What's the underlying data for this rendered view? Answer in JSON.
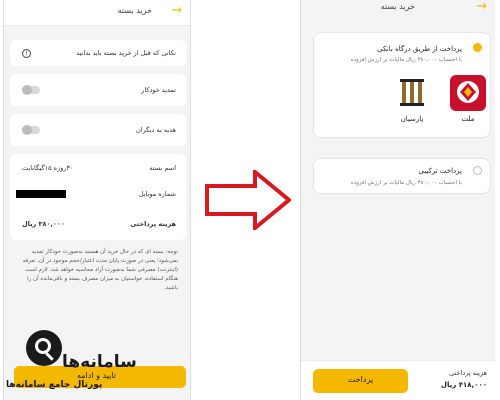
{
  "left_screen": {
    "title": "خرید بسته",
    "notice": "نکاتی که قبل از خرید بسته باید بدانید",
    "auto_renew_label": "تمدید خودکار",
    "gift_label": "هدیه به دیگران",
    "package_name_label": "اسم بسته",
    "package_name_value": "۳۰روزه ۱۵گیگابایت",
    "mobile_label": "شماره موبایل",
    "payment_label": "هزینه پرداختی",
    "payment_value": "۳۸۰,۰۰۰ ریال",
    "note": "توجه: بسته ای که در حال خرید آن هستید به‌صورت خودکار تمدید نمی‌شود؛ یعنی در صورت پایان مدت اعتبار/حجم موجود در آن، تعرفه (اینترنت) مصرفی شما به‌صورت آزاد محاسبه خواهد شد. لازم است هنگام استفاده، خواستیان به میزان مصرف بسته و باقی‌مانده آن را باشید.",
    "confirm_label": "تایید و ادامه"
  },
  "watermark": {
    "main": "سامانه‌ها",
    "sub": "پورتال جامع سامانه‌ها"
  },
  "right_screen": {
    "title": "خرید بسته",
    "bank_option_title": "پرداخت از طریق درگاه بانکی",
    "bank_option_sub": "با احتساب ۳۸۰,۰۰۰ ریال مالیات بر ارزش افزوده",
    "banks": [
      {
        "name": "ملت"
      },
      {
        "name": "پارسیان"
      }
    ],
    "combo_option_title": "پرداخت ترکیبی",
    "combo_option_sub": "با احتساب ۳۸۰,۰۰۰ ریال مالیات بر ارزش افزوده",
    "fee_label": "هزینه پرداختی",
    "fee_value": "۴۱۸,۰۰۰ ریال",
    "pay_label": "پرداخت"
  },
  "colors": {
    "accent": "#f5b800",
    "arrow": "#d71920",
    "mellat": "#c8102e",
    "parsian": "#8b6b2e"
  }
}
